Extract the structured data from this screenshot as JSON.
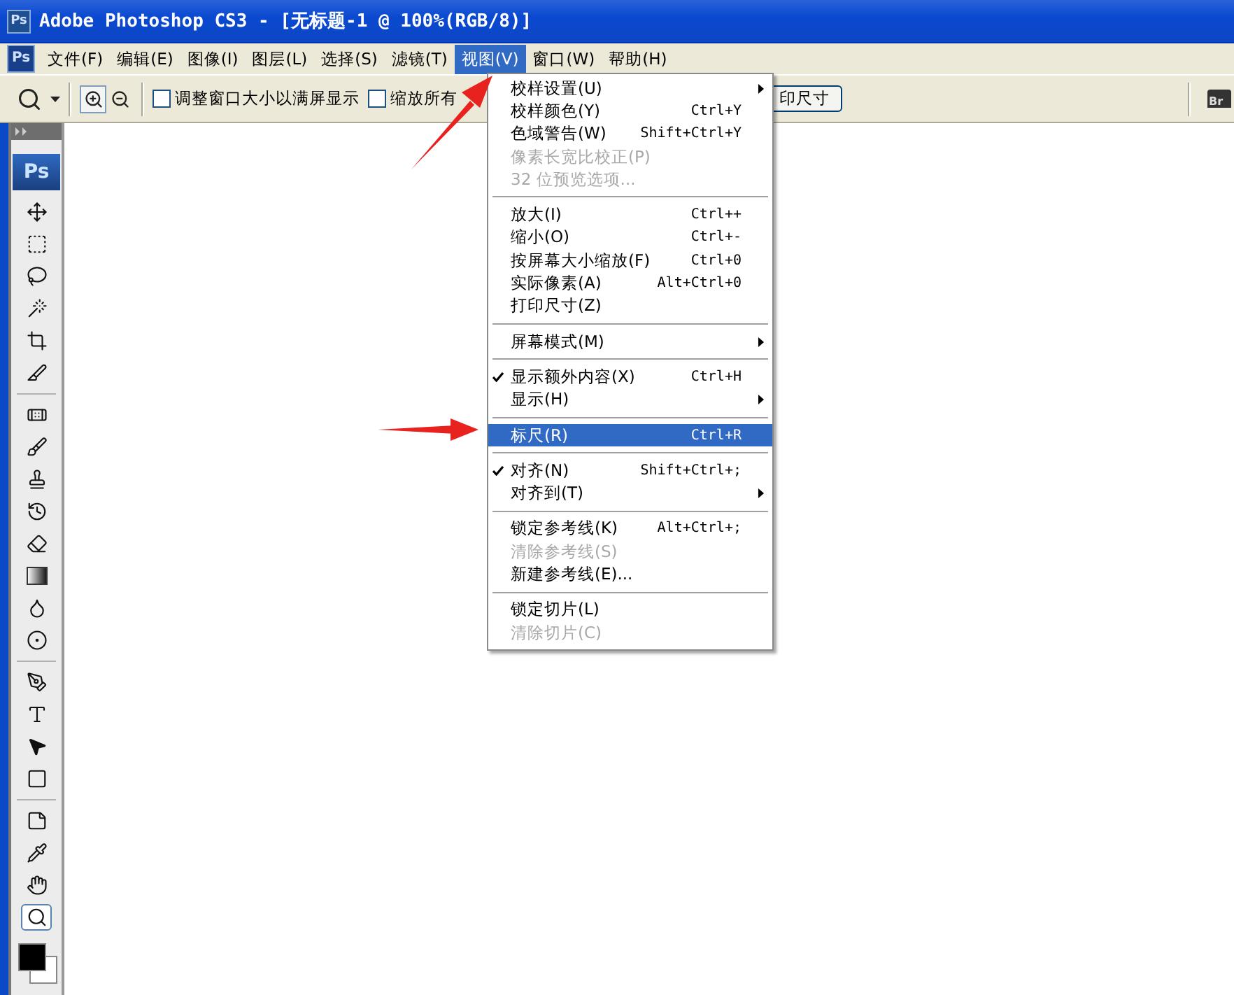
{
  "title_bar": {
    "app_icon_text": "Ps",
    "title": "Adobe Photoshop CS3 - [无标题-1 @ 100%(RGB/8)]"
  },
  "menu_bar": {
    "app_icon_text": "Ps",
    "items": [
      {
        "label": "文件(F)",
        "selected": false
      },
      {
        "label": "编辑(E)",
        "selected": false
      },
      {
        "label": "图像(I)",
        "selected": false
      },
      {
        "label": "图层(L)",
        "selected": false
      },
      {
        "label": "选择(S)",
        "selected": false
      },
      {
        "label": "滤镜(T)",
        "selected": false
      },
      {
        "label": "视图(V)",
        "selected": true
      },
      {
        "label": "窗口(W)",
        "selected": false
      },
      {
        "label": "帮助(H)",
        "selected": false
      }
    ]
  },
  "options_bar": {
    "checkboxes": [
      {
        "label": "调整窗口大小以满屏显示",
        "checked": false
      },
      {
        "label": "缩放所有",
        "checked": false
      }
    ],
    "button": "印尺寸",
    "bridge_icon_text": "Br"
  },
  "toolbox": {
    "logo": "Ps",
    "tools": [
      {
        "kind": "move",
        "selected": false
      },
      {
        "kind": "marquee",
        "selected": false
      },
      {
        "kind": "lasso",
        "selected": false
      },
      {
        "kind": "wand",
        "selected": false
      },
      {
        "kind": "crop",
        "selected": false
      },
      {
        "kind": "slice",
        "selected": false
      },
      {
        "kind": "sep"
      },
      {
        "kind": "heal",
        "selected": false
      },
      {
        "kind": "brush",
        "selected": false
      },
      {
        "kind": "stamp",
        "selected": false
      },
      {
        "kind": "history",
        "selected": false
      },
      {
        "kind": "eraser",
        "selected": false
      },
      {
        "kind": "gradient",
        "selected": false
      },
      {
        "kind": "blur",
        "selected": false
      },
      {
        "kind": "dodge",
        "selected": false
      },
      {
        "kind": "sep"
      },
      {
        "kind": "pen",
        "selected": false
      },
      {
        "kind": "type",
        "selected": false
      },
      {
        "kind": "path",
        "selected": false
      },
      {
        "kind": "shape",
        "selected": false
      },
      {
        "kind": "sep"
      },
      {
        "kind": "notes",
        "selected": false
      },
      {
        "kind": "eyedropper",
        "selected": false
      },
      {
        "kind": "hand",
        "selected": false
      },
      {
        "kind": "zoom",
        "selected": true
      }
    ]
  },
  "view_menu": {
    "sections": [
      [
        {
          "label": "校样设置(U)",
          "checked": false,
          "disabled": false,
          "submenu": true,
          "selected": false
        },
        {
          "label": "校样颜色(Y)",
          "shortcut": "Ctrl+Y",
          "checked": false,
          "disabled": false,
          "submenu": false,
          "selected": false
        },
        {
          "label": "色域警告(W)",
          "shortcut": "Shift+Ctrl+Y",
          "checked": false,
          "disabled": false,
          "submenu": false,
          "selected": false
        },
        {
          "label": "像素长宽比校正(P)",
          "checked": false,
          "disabled": true,
          "submenu": false,
          "selected": false
        },
        {
          "label": "32 位预览选项...",
          "checked": false,
          "disabled": true,
          "submenu": false,
          "selected": false
        }
      ],
      [
        {
          "label": "放大(I)",
          "shortcut": "Ctrl++",
          "checked": false,
          "disabled": false,
          "submenu": false,
          "selected": false
        },
        {
          "label": "缩小(O)",
          "shortcut": "Ctrl+-",
          "checked": false,
          "disabled": false,
          "submenu": false,
          "selected": false
        },
        {
          "label": "按屏幕大小缩放(F)",
          "shortcut": "Ctrl+0",
          "checked": false,
          "disabled": false,
          "submenu": false,
          "selected": false
        },
        {
          "label": "实际像素(A)",
          "shortcut": "Alt+Ctrl+0",
          "checked": false,
          "disabled": false,
          "submenu": false,
          "selected": false
        },
        {
          "label": "打印尺寸(Z)",
          "checked": false,
          "disabled": false,
          "submenu": false,
          "selected": false
        }
      ],
      [
        {
          "label": "屏幕模式(M)",
          "checked": false,
          "disabled": false,
          "submenu": true,
          "selected": false
        }
      ],
      [
        {
          "label": "显示额外内容(X)",
          "shortcut": "Ctrl+H",
          "checked": true,
          "disabled": false,
          "submenu": false,
          "selected": false
        },
        {
          "label": "显示(H)",
          "checked": false,
          "disabled": false,
          "submenu": true,
          "selected": false
        }
      ],
      [
        {
          "label": "标尺(R)",
          "shortcut": "Ctrl+R",
          "checked": false,
          "disabled": false,
          "submenu": false,
          "selected": true
        }
      ],
      [
        {
          "label": "对齐(N)",
          "shortcut": "Shift+Ctrl+;",
          "checked": true,
          "disabled": false,
          "submenu": false,
          "selected": false
        },
        {
          "label": "对齐到(T)",
          "checked": false,
          "disabled": false,
          "submenu": true,
          "selected": false
        }
      ],
      [
        {
          "label": "锁定参考线(K)",
          "shortcut": "Alt+Ctrl+;",
          "checked": false,
          "disabled": false,
          "submenu": false,
          "selected": false
        },
        {
          "label": "清除参考线(S)",
          "checked": false,
          "disabled": true,
          "submenu": false,
          "selected": false
        },
        {
          "label": "新建参考线(E)...",
          "checked": false,
          "disabled": false,
          "submenu": false,
          "selected": false
        }
      ],
      [
        {
          "label": "锁定切片(L)",
          "checked": false,
          "disabled": false,
          "submenu": false,
          "selected": false
        },
        {
          "label": "清除切片(C)",
          "checked": false,
          "disabled": true,
          "submenu": false,
          "selected": false
        }
      ]
    ]
  }
}
